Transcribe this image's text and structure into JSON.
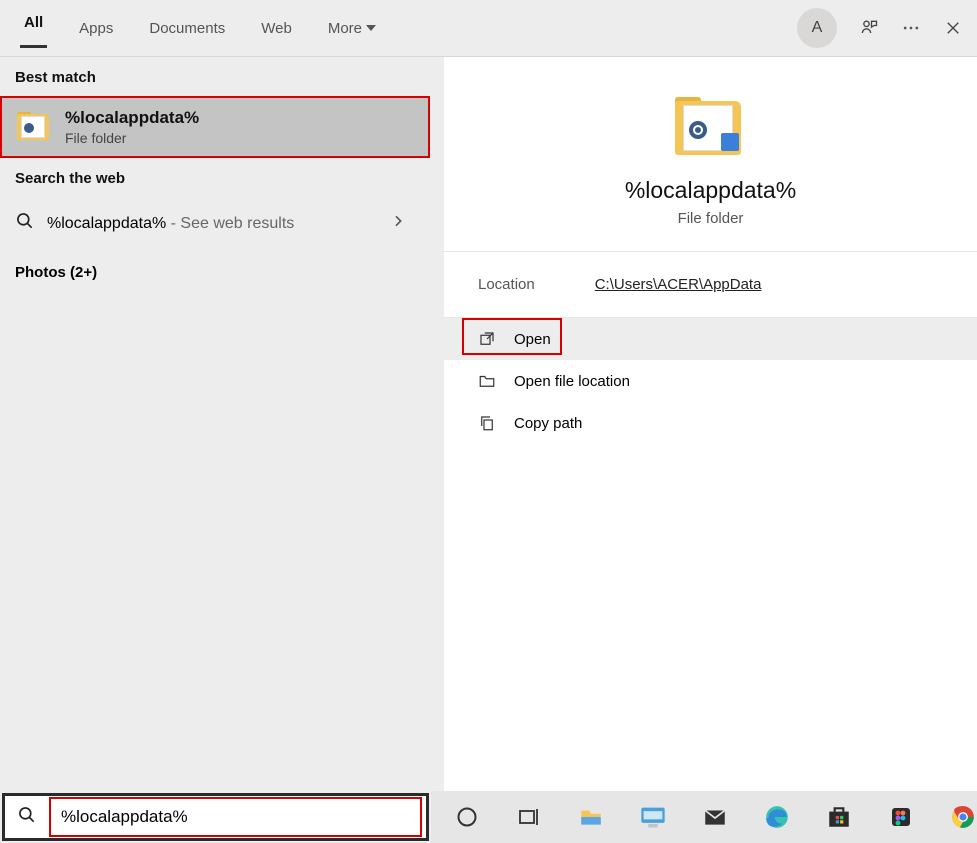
{
  "top": {
    "tabs": [
      "All",
      "Apps",
      "Documents",
      "Web",
      "More"
    ],
    "avatar_letter": "A"
  },
  "left": {
    "best_match_header": "Best match",
    "best_match": {
      "title": "%localappdata%",
      "subtitle": "File folder"
    },
    "search_web_header": "Search the web",
    "web_result": {
      "term": "%localappdata%",
      "suffix": " - See web results"
    },
    "photos": "Photos (2+)"
  },
  "right": {
    "title": "%localappdata%",
    "subtitle": "File folder",
    "location_label": "Location",
    "location_path": "C:\\Users\\ACER\\AppData",
    "actions": {
      "open": "Open",
      "open_loc": "Open file location",
      "copy_path": "Copy path"
    }
  },
  "search": {
    "value": "%localappdata%"
  }
}
